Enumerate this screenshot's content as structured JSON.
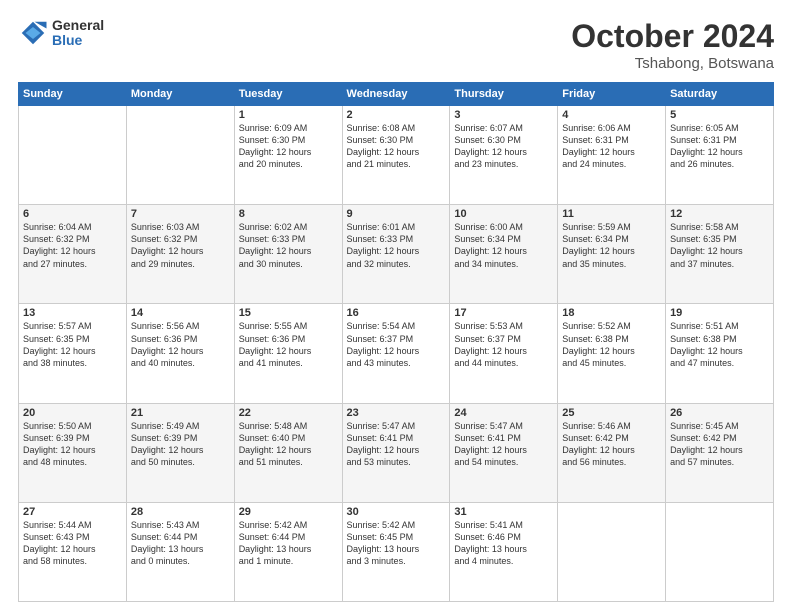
{
  "header": {
    "logo": {
      "general": "General",
      "blue": "Blue"
    },
    "title": "October 2024",
    "location": "Tshabong, Botswana"
  },
  "weekdays": [
    "Sunday",
    "Monday",
    "Tuesday",
    "Wednesday",
    "Thursday",
    "Friday",
    "Saturday"
  ],
  "weeks": [
    [
      {
        "day": "",
        "info": ""
      },
      {
        "day": "",
        "info": ""
      },
      {
        "day": "1",
        "info": "Sunrise: 6:09 AM\nSunset: 6:30 PM\nDaylight: 12 hours\nand 20 minutes."
      },
      {
        "day": "2",
        "info": "Sunrise: 6:08 AM\nSunset: 6:30 PM\nDaylight: 12 hours\nand 21 minutes."
      },
      {
        "day": "3",
        "info": "Sunrise: 6:07 AM\nSunset: 6:30 PM\nDaylight: 12 hours\nand 23 minutes."
      },
      {
        "day": "4",
        "info": "Sunrise: 6:06 AM\nSunset: 6:31 PM\nDaylight: 12 hours\nand 24 minutes."
      },
      {
        "day": "5",
        "info": "Sunrise: 6:05 AM\nSunset: 6:31 PM\nDaylight: 12 hours\nand 26 minutes."
      }
    ],
    [
      {
        "day": "6",
        "info": "Sunrise: 6:04 AM\nSunset: 6:32 PM\nDaylight: 12 hours\nand 27 minutes."
      },
      {
        "day": "7",
        "info": "Sunrise: 6:03 AM\nSunset: 6:32 PM\nDaylight: 12 hours\nand 29 minutes."
      },
      {
        "day": "8",
        "info": "Sunrise: 6:02 AM\nSunset: 6:33 PM\nDaylight: 12 hours\nand 30 minutes."
      },
      {
        "day": "9",
        "info": "Sunrise: 6:01 AM\nSunset: 6:33 PM\nDaylight: 12 hours\nand 32 minutes."
      },
      {
        "day": "10",
        "info": "Sunrise: 6:00 AM\nSunset: 6:34 PM\nDaylight: 12 hours\nand 34 minutes."
      },
      {
        "day": "11",
        "info": "Sunrise: 5:59 AM\nSunset: 6:34 PM\nDaylight: 12 hours\nand 35 minutes."
      },
      {
        "day": "12",
        "info": "Sunrise: 5:58 AM\nSunset: 6:35 PM\nDaylight: 12 hours\nand 37 minutes."
      }
    ],
    [
      {
        "day": "13",
        "info": "Sunrise: 5:57 AM\nSunset: 6:35 PM\nDaylight: 12 hours\nand 38 minutes."
      },
      {
        "day": "14",
        "info": "Sunrise: 5:56 AM\nSunset: 6:36 PM\nDaylight: 12 hours\nand 40 minutes."
      },
      {
        "day": "15",
        "info": "Sunrise: 5:55 AM\nSunset: 6:36 PM\nDaylight: 12 hours\nand 41 minutes."
      },
      {
        "day": "16",
        "info": "Sunrise: 5:54 AM\nSunset: 6:37 PM\nDaylight: 12 hours\nand 43 minutes."
      },
      {
        "day": "17",
        "info": "Sunrise: 5:53 AM\nSunset: 6:37 PM\nDaylight: 12 hours\nand 44 minutes."
      },
      {
        "day": "18",
        "info": "Sunrise: 5:52 AM\nSunset: 6:38 PM\nDaylight: 12 hours\nand 45 minutes."
      },
      {
        "day": "19",
        "info": "Sunrise: 5:51 AM\nSunset: 6:38 PM\nDaylight: 12 hours\nand 47 minutes."
      }
    ],
    [
      {
        "day": "20",
        "info": "Sunrise: 5:50 AM\nSunset: 6:39 PM\nDaylight: 12 hours\nand 48 minutes."
      },
      {
        "day": "21",
        "info": "Sunrise: 5:49 AM\nSunset: 6:39 PM\nDaylight: 12 hours\nand 50 minutes."
      },
      {
        "day": "22",
        "info": "Sunrise: 5:48 AM\nSunset: 6:40 PM\nDaylight: 12 hours\nand 51 minutes."
      },
      {
        "day": "23",
        "info": "Sunrise: 5:47 AM\nSunset: 6:41 PM\nDaylight: 12 hours\nand 53 minutes."
      },
      {
        "day": "24",
        "info": "Sunrise: 5:47 AM\nSunset: 6:41 PM\nDaylight: 12 hours\nand 54 minutes."
      },
      {
        "day": "25",
        "info": "Sunrise: 5:46 AM\nSunset: 6:42 PM\nDaylight: 12 hours\nand 56 minutes."
      },
      {
        "day": "26",
        "info": "Sunrise: 5:45 AM\nSunset: 6:42 PM\nDaylight: 12 hours\nand 57 minutes."
      }
    ],
    [
      {
        "day": "27",
        "info": "Sunrise: 5:44 AM\nSunset: 6:43 PM\nDaylight: 12 hours\nand 58 minutes."
      },
      {
        "day": "28",
        "info": "Sunrise: 5:43 AM\nSunset: 6:44 PM\nDaylight: 13 hours\nand 0 minutes."
      },
      {
        "day": "29",
        "info": "Sunrise: 5:42 AM\nSunset: 6:44 PM\nDaylight: 13 hours\nand 1 minute."
      },
      {
        "day": "30",
        "info": "Sunrise: 5:42 AM\nSunset: 6:45 PM\nDaylight: 13 hours\nand 3 minutes."
      },
      {
        "day": "31",
        "info": "Sunrise: 5:41 AM\nSunset: 6:46 PM\nDaylight: 13 hours\nand 4 minutes."
      },
      {
        "day": "",
        "info": ""
      },
      {
        "day": "",
        "info": ""
      }
    ]
  ]
}
